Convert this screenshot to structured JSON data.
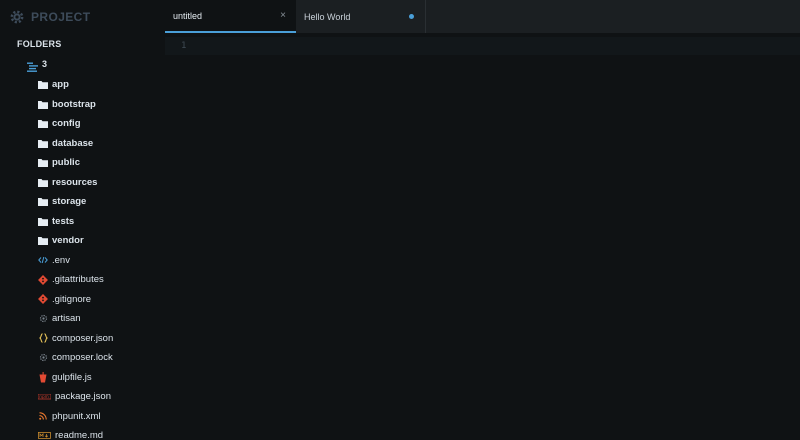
{
  "sidebar": {
    "title": "PROJECT",
    "folders_label": "FOLDERS",
    "root": {
      "label": "3",
      "icon": "folder-open-icon"
    },
    "items": [
      {
        "label": "app",
        "type": "folder",
        "icon": "folder-icon"
      },
      {
        "label": "bootstrap",
        "type": "folder",
        "icon": "folder-icon"
      },
      {
        "label": "config",
        "type": "folder",
        "icon": "folder-icon"
      },
      {
        "label": "database",
        "type": "folder",
        "icon": "folder-icon"
      },
      {
        "label": "public",
        "type": "folder",
        "icon": "folder-icon"
      },
      {
        "label": "resources",
        "type": "folder",
        "icon": "folder-icon"
      },
      {
        "label": "storage",
        "type": "folder",
        "icon": "folder-icon"
      },
      {
        "label": "tests",
        "type": "folder",
        "icon": "folder-icon"
      },
      {
        "label": "vendor",
        "type": "folder",
        "icon": "folder-icon"
      },
      {
        "label": ".env",
        "type": "file",
        "icon": "code-icon"
      },
      {
        "label": ".gitattributes",
        "type": "file",
        "icon": "git-icon"
      },
      {
        "label": ".gitignore",
        "type": "file",
        "icon": "git-icon"
      },
      {
        "label": "artisan",
        "type": "file",
        "icon": "gear-file-icon"
      },
      {
        "label": "composer.json",
        "type": "file",
        "icon": "json-icon"
      },
      {
        "label": "composer.lock",
        "type": "file",
        "icon": "gear-file-icon"
      },
      {
        "label": "gulpfile.js",
        "type": "file",
        "icon": "gulp-icon"
      },
      {
        "label": "package.json",
        "type": "file",
        "icon": "npm-icon"
      },
      {
        "label": "phpunit.xml",
        "type": "file",
        "icon": "rss-icon"
      },
      {
        "label": "readme.md",
        "type": "file",
        "icon": "markdown-icon"
      }
    ]
  },
  "tabs": [
    {
      "label": "untitled",
      "active": true,
      "close": "×"
    },
    {
      "label": "Hello World",
      "active": false,
      "modified": true
    }
  ],
  "editor": {
    "line_number": "1"
  },
  "colors": {
    "accent": "#4a9fd8",
    "git": "#e24a33",
    "json": "#e8c45a",
    "gulp": "#e24a33",
    "npm": "#c0392b",
    "rss": "#e8772e"
  }
}
